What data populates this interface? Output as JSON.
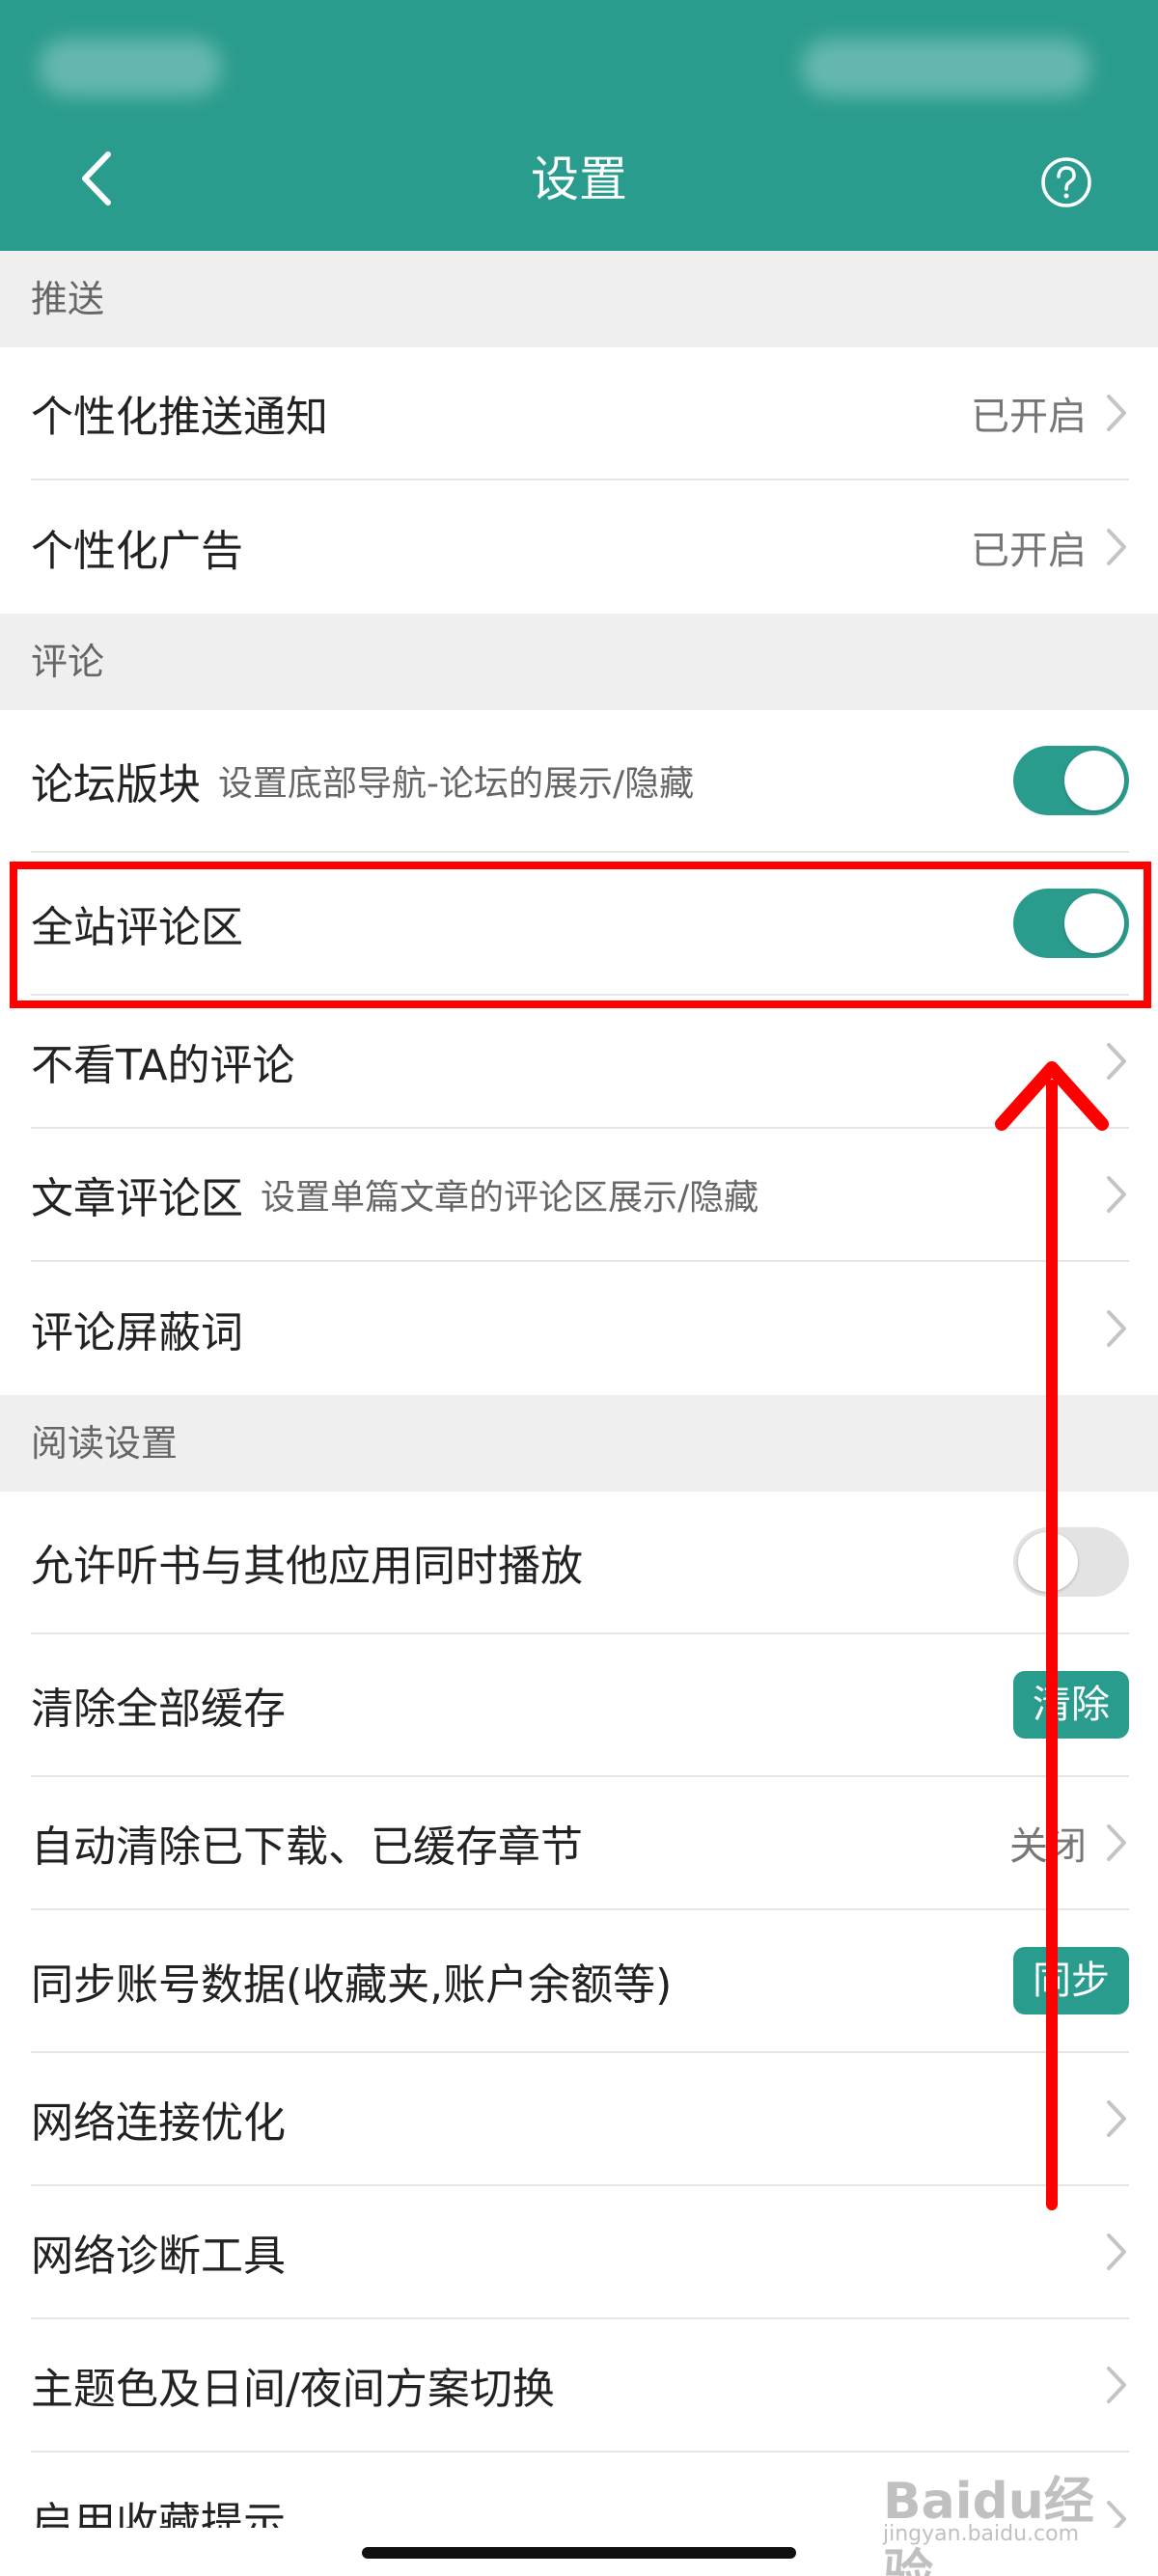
{
  "header": {
    "title": "设置",
    "background_color": "#2a9c8e",
    "back_icon": "chevron-left-icon",
    "help_icon": "question-circle-icon"
  },
  "sections": [
    {
      "title": "推送",
      "rows": [
        {
          "label": "个性化推送通知",
          "value": "已开启",
          "control": "chevron"
        },
        {
          "label": "个性化广告",
          "value": "已开启",
          "control": "chevron"
        }
      ]
    },
    {
      "title": "评论",
      "rows": [
        {
          "label": "论坛版块",
          "subtitle": "设置底部导航-论坛的展示/隐藏",
          "control": "toggle",
          "checked": true
        },
        {
          "label": "全站评论区",
          "control": "toggle",
          "checked": true,
          "highlighted": true
        },
        {
          "label": "不看TA的评论",
          "control": "chevron"
        },
        {
          "label": "文章评论区",
          "subtitle": "设置单篇文章的评论区展示/隐藏",
          "control": "chevron"
        },
        {
          "label": "评论屏蔽词",
          "control": "chevron"
        }
      ]
    },
    {
      "title": "阅读设置",
      "rows": [
        {
          "label": "允许听书与其他应用同时播放",
          "control": "toggle",
          "checked": false
        },
        {
          "label": "清除全部缓存",
          "control": "button",
          "button_label": "清除"
        },
        {
          "label": "自动清除已下载、已缓存章节",
          "value": "关闭",
          "control": "chevron"
        },
        {
          "label": "同步账号数据(收藏夹,账户余额等)",
          "control": "button",
          "button_label": "同步"
        },
        {
          "label": "网络连接优化",
          "control": "chevron"
        },
        {
          "label": "网络诊断工具",
          "control": "chevron"
        },
        {
          "label": "主题色及日间/夜间方案切换",
          "control": "chevron"
        },
        {
          "label": "启用收藏提示",
          "control": "chevron"
        }
      ]
    }
  ],
  "annotation": {
    "highlight_color": "#ff0000",
    "arrow_direction": "up"
  },
  "watermark": {
    "text": "Baidu经验",
    "sub": "jingyan.baidu.com"
  },
  "colors": {
    "accent": "#2a9c8e",
    "section_bg": "#efefef",
    "annotation_red": "#ff0000"
  }
}
